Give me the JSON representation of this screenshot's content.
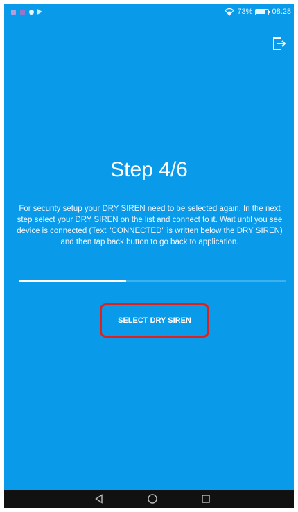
{
  "status_bar": {
    "battery_percent": "73%",
    "battery_level": 0.73,
    "time": "08:28",
    "notification_icons": [
      "app-notification-icon",
      "app-notification-icon",
      "app-notification-icon",
      "play-store-icon"
    ]
  },
  "header": {
    "exit_icon": "exit-icon"
  },
  "main": {
    "title": "Step 4/6",
    "description": "For security setup your DRY SIREN need to be selected again. In the next step select your DRY SIREN on the list and connect to it. Wait until you see device is connected (Text \"CONNECTED\" is written below the DRY SIREN) and then tap back button to go back to application.",
    "progress": 0.4,
    "select_button_label": "SELECT DRY SIREN",
    "highlight_color": "#e0201b",
    "background_color": "#0a9aea"
  },
  "nav_bar": {
    "buttons": [
      "back-icon",
      "home-icon",
      "recent-apps-icon"
    ]
  }
}
